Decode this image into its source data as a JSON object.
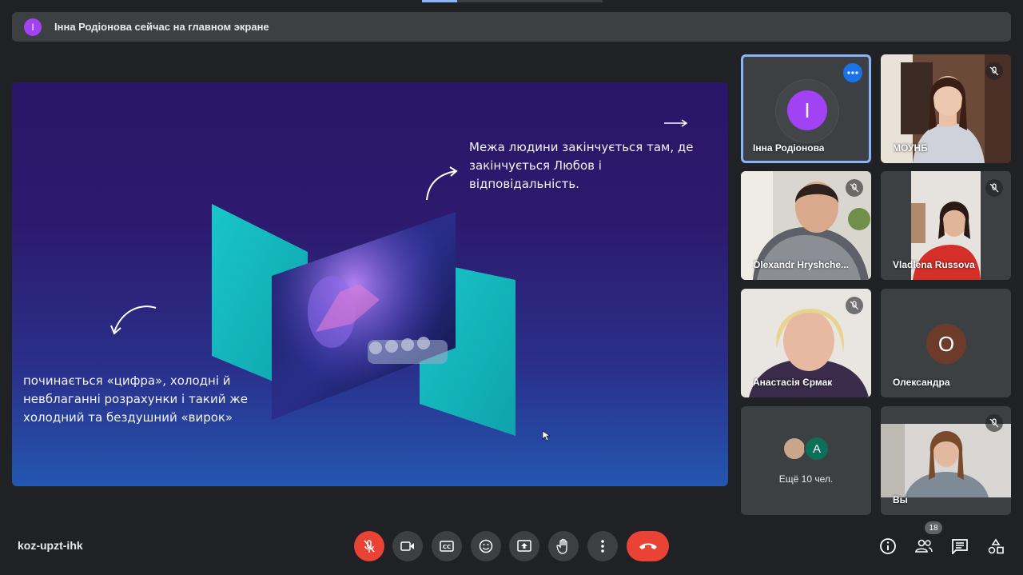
{
  "banner": {
    "avatar_letter": "I",
    "text": "Інна Родіонова сейчас на главном экране"
  },
  "presentation": {
    "text_top": "Межа людини закінчується там, де закінчується Любов і відповідальність.",
    "text_bottom": "починається «цифра», холодні й невблаганні розрахунки і такий же холодний та бездушний «вирок»"
  },
  "participants": [
    {
      "name": "Інна Родіонова",
      "avatar": "I",
      "avatar_color": "#a142f4",
      "active": true
    },
    {
      "name": "МОУНБ",
      "muted": true
    },
    {
      "name": "Olexandr Hryshche...",
      "muted": true
    },
    {
      "name": "Vladlena Russova",
      "muted": true
    },
    {
      "name": "Анастасія Єрмак",
      "muted": true
    },
    {
      "name": "Олександра",
      "avatar": "О",
      "avatar_color": "#6d3b2a"
    },
    {
      "more_label": "Ещё 10 чел.",
      "avatar_letter": "A",
      "avatar_color": "#0b6f5a"
    },
    {
      "name": "Вы",
      "muted": true
    }
  ],
  "bottom": {
    "meeting_code": "koz-upzt-ihk",
    "participants_count": "18"
  },
  "colors": {
    "background": "#202124",
    "tile": "#3c4043",
    "accent": "#8ab4f8",
    "danger": "#ea4335"
  }
}
